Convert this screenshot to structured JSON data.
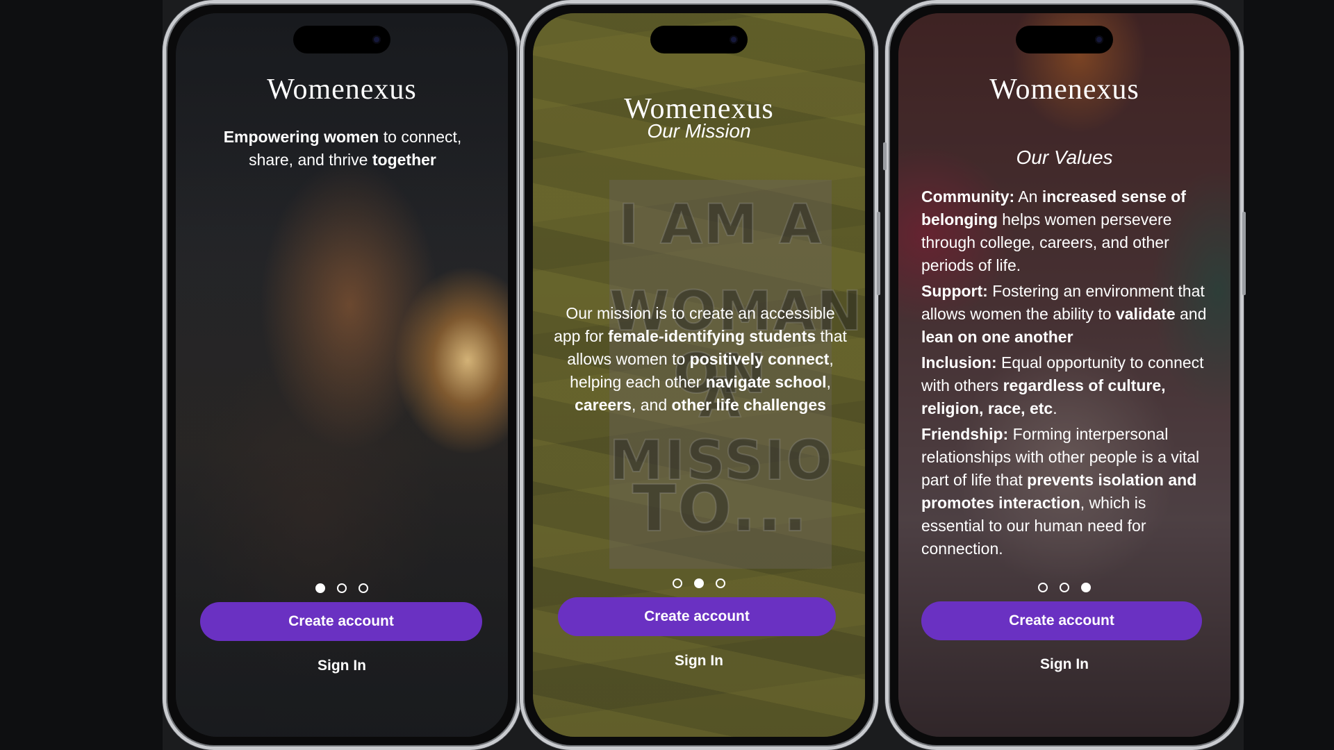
{
  "brand": {
    "name": "Womenexus",
    "accent": "#6a31c2"
  },
  "screens": [
    {
      "tagline": {
        "parts": [
          {
            "t": "Empowering women",
            "b": true
          },
          {
            "t": " to connect, share, and thrive ",
            "b": false
          },
          {
            "t": "together",
            "b": true
          }
        ]
      },
      "pager": {
        "count": 3,
        "active": 0
      },
      "primary_button": "Create account",
      "secondary_link": "Sign In"
    },
    {
      "title": "Our Mission",
      "poster_lines": [
        "I AM A",
        "WOMAN ON",
        "A MISSIO",
        "TO..."
      ],
      "body": {
        "parts": [
          {
            "t": "Our mission is to create an accessible app for ",
            "b": false
          },
          {
            "t": "female-identifying students",
            "b": true
          },
          {
            "t": " that allows women to ",
            "b": false
          },
          {
            "t": "positively connect",
            "b": true
          },
          {
            "t": ", helping each other ",
            "b": false
          },
          {
            "t": "navigate school",
            "b": true
          },
          {
            "t": ", ",
            "b": false
          },
          {
            "t": "careers",
            "b": true
          },
          {
            "t": ", and ",
            "b": false
          },
          {
            "t": "other life challenges",
            "b": true
          }
        ]
      },
      "pager": {
        "count": 3,
        "active": 1
      },
      "primary_button": "Create account",
      "secondary_link": "Sign In"
    },
    {
      "title": "Our Values",
      "values": [
        {
          "parts": [
            {
              "t": "Community:",
              "b": true
            },
            {
              "t": " An ",
              "b": false
            },
            {
              "t": "increased sense of belonging",
              "b": true
            },
            {
              "t": " helps women persevere through college, careers, and other periods of life.",
              "b": false
            }
          ]
        },
        {
          "parts": [
            {
              "t": "Support:",
              "b": true
            },
            {
              "t": " Fostering an environment that allows women the ability to ",
              "b": false
            },
            {
              "t": "validate",
              "b": true
            },
            {
              "t": " and ",
              "b": false
            },
            {
              "t": "lean on one another",
              "b": true
            }
          ]
        },
        {
          "parts": [
            {
              "t": "Inclusion:",
              "b": true
            },
            {
              "t": " Equal opportunity to connect with others ",
              "b": false
            },
            {
              "t": "regardless of culture, religion, race, etc",
              "b": true
            },
            {
              "t": ".",
              "b": false
            }
          ]
        },
        {
          "parts": [
            {
              "t": "Friendship:",
              "b": true
            },
            {
              "t": " Forming interpersonal relationships with other people is a vital part of life that ",
              "b": false
            },
            {
              "t": "prevents isolation and promotes interaction",
              "b": true
            },
            {
              "t": ", which is essential to our human need for connection.",
              "b": false
            }
          ]
        }
      ],
      "pager": {
        "count": 3,
        "active": 2
      },
      "primary_button": "Create account",
      "secondary_link": "Sign In"
    }
  ]
}
